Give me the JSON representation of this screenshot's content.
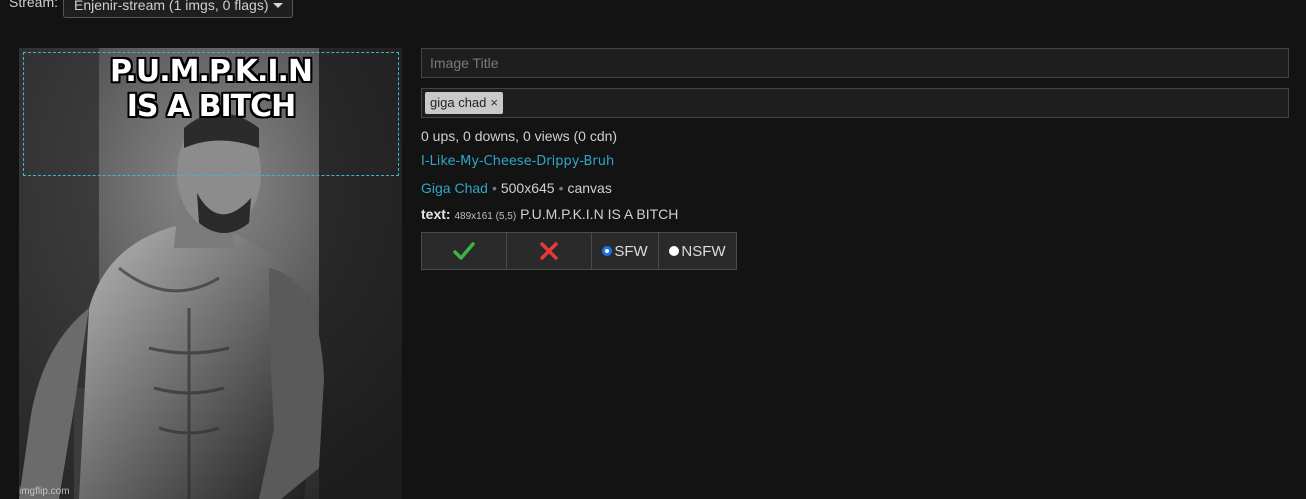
{
  "topbar": {
    "stream_label": "Stream:",
    "stream_value": "Enjenir-stream (1 imgs, 0 flags)"
  },
  "image": {
    "meme_text": "P.U.M.P.K.I.N\nIS A BITCH",
    "watermark": "imgflip.com"
  },
  "form": {
    "title_placeholder": "Image Title",
    "title_value": "",
    "tags": [
      "giga chad"
    ],
    "tag_remove_symbol": "×"
  },
  "meta": {
    "stats": "0 ups, 0 downs, 0 views (0 cdn)",
    "author": "I-Like-My-Cheese-Drippy-Bruh",
    "template_name": "Giga Chad",
    "separator": "•",
    "dimensions": "500x645",
    "render_type": "canvas",
    "text_label": "text:",
    "text_box_info": "489x161 (5,5)",
    "text_content": "P.U.M.P.K.I.N IS A BITCH"
  },
  "actions": {
    "approve_icon": "checkmark-icon",
    "reject_icon": "cross-icon",
    "sfw_label": "SFW",
    "nsfw_label": "NSFW",
    "selected_rating": "SFW"
  },
  "colors": {
    "background": "#131313",
    "link": "#2fa6c9",
    "approve": "#3cb44a",
    "reject": "#e53935",
    "text_box_outline": "#3fb7c8"
  }
}
